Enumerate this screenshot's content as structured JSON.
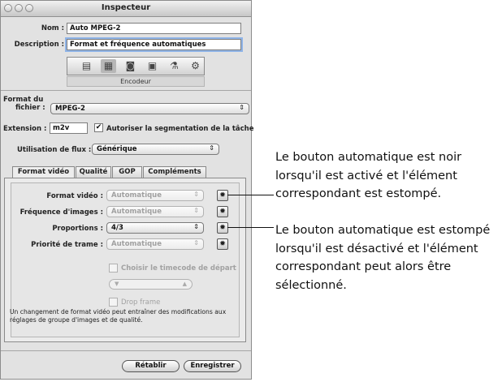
{
  "window": {
    "title": "Inspecteur",
    "name_label": "Nom :",
    "name_value": "Auto MPEG-2",
    "description_label": "Description :",
    "description_value": "Format et fréquence automatiques",
    "toolbar_icons": [
      "document-icon",
      "film-icon",
      "camera-icon",
      "layers-icon",
      "filter-icon",
      "gear-icon"
    ],
    "section_label": "Encodeur"
  },
  "encoder": {
    "format_label_line1": "Format du",
    "format_label_line2": "fichier :",
    "format_value": "MPEG-2",
    "extension_label": "Extension :",
    "extension_value": "m2v",
    "segment_checked": true,
    "segment_label": "Autoriser la segmentation de la tâche",
    "flux_label": "Utilisation de flux :",
    "flux_value": "Générique"
  },
  "tabs": [
    {
      "label": "Format vidéo",
      "selected": true
    },
    {
      "label": "Qualité",
      "selected": false
    },
    {
      "label": "GOP",
      "selected": false
    },
    {
      "label": "Compléments",
      "selected": false
    }
  ],
  "video": {
    "rows": [
      {
        "label": "Format vidéo :",
        "value": "Automatique",
        "dim": true
      },
      {
        "label": "Fréquence d'images :",
        "value": "Automatique",
        "dim": true
      },
      {
        "label": "Proportions :",
        "value": "4/3",
        "dim": false
      },
      {
        "label": "Priorité de trame :",
        "value": "Automatique",
        "dim": true
      }
    ],
    "timecode_label": "Choisir le timecode de départ",
    "timecode_checked": false,
    "drop_frame_label": "Drop frame",
    "drop_frame_checked": false,
    "note": "Un changement de format vidéo peut entraîner des modifications aux réglages de groupe d'images et de qualité."
  },
  "buttons": {
    "reset": "Rétablir",
    "save": "Enregistrer"
  },
  "callouts": {
    "first": "Le bouton automatique est noir lorsqu'il est activé et l'élément correspondant est estompé.",
    "second": "Le bouton automatique est estompé lorsqu'il est désactivé et l'élément correspondant peut alors être sélectionné."
  }
}
